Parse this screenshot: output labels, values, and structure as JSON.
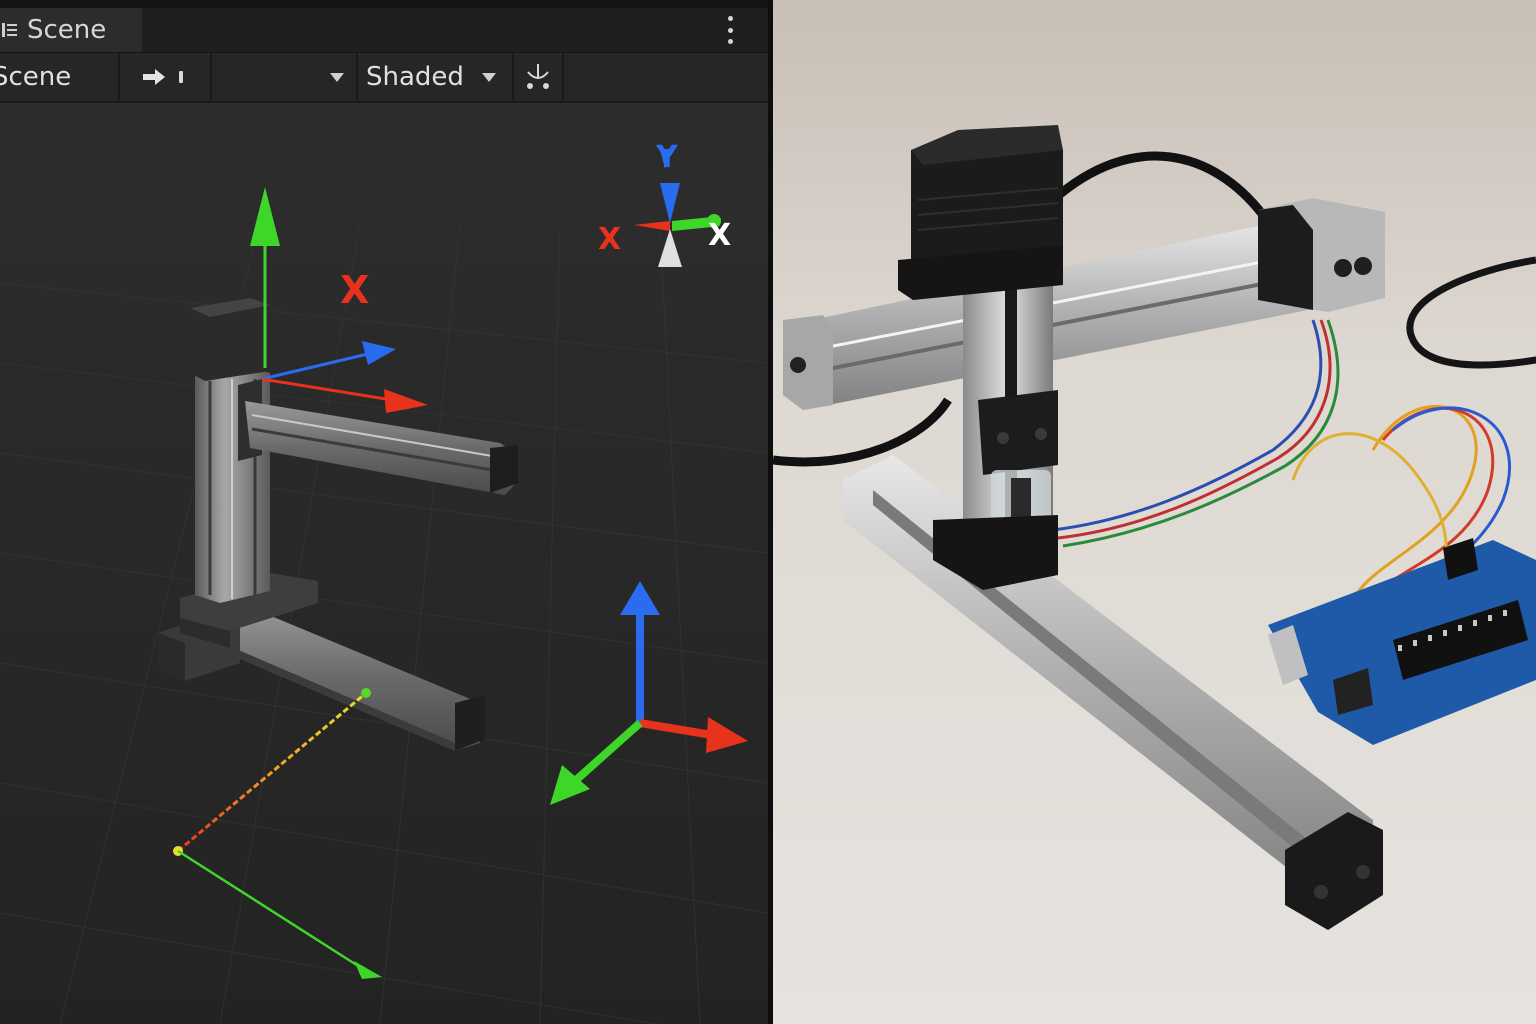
{
  "editor": {
    "tab": {
      "label": "Scene",
      "icon": "hierarchy-list-icon"
    },
    "menu_icon": "more-vertical-icon",
    "toolbar": {
      "scene_label": "Scene",
      "move_tool_icon": "move-arrow-icon",
      "empty_dropdown_value": "",
      "shading_mode": "Shaded",
      "gizmo_icon": "gizmo-toggle-icon"
    },
    "viewport": {
      "axis_gizmo": {
        "up_label": "Y",
        "left_label": "X",
        "right_label": "X"
      },
      "floating_axis_label": "X"
    }
  },
  "colors": {
    "axis_x": "#e8321c",
    "axis_y": "#3fd62a",
    "axis_z": "#2a6cf0",
    "panel_bg": "#2a2a2a",
    "toolbar_bg": "#262626"
  },
  "photo": {
    "subject": "photo-of-physical-xy-plotter-with-arduino"
  }
}
